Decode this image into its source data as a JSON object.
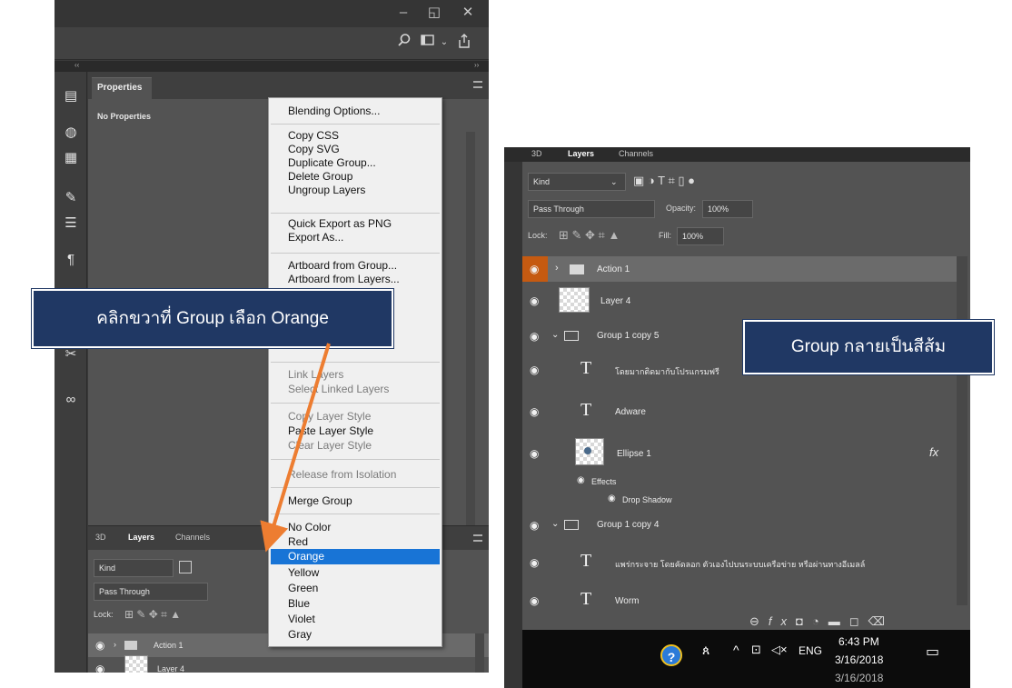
{
  "left_screenshot": {
    "window_controls": {
      "minimize": "–",
      "restore": "◱",
      "close": "✕"
    },
    "toolbar_icons": [
      "search-icon",
      "workspace-icon",
      "chevron-down-icon",
      "share-icon"
    ],
    "collapse_left": "‹‹",
    "collapse_right": "››",
    "properties_panel": {
      "tab_label": "Properties",
      "empty_text": "No Properties"
    },
    "context_menu": {
      "items": [
        {
          "label": "Blending Options...",
          "disabled": false
        },
        {
          "label": "Copy CSS",
          "disabled": false
        },
        {
          "label": "Copy SVG",
          "disabled": false
        },
        {
          "label": "Duplicate Group...",
          "disabled": false
        },
        {
          "label": "Delete Group",
          "disabled": false
        },
        {
          "label": "Ungroup Layers",
          "disabled": false
        },
        {
          "label": "Quick Export as PNG",
          "disabled": false
        },
        {
          "label": "Export As...",
          "disabled": false
        },
        {
          "label": "Artboard from Group...",
          "disabled": false
        },
        {
          "label": "Artboard from Layers...",
          "disabled": false
        },
        {
          "label": "Link Layers",
          "disabled": true
        },
        {
          "label": "Select Linked Layers",
          "disabled": true
        },
        {
          "label": "Copy Layer Style",
          "disabled": true
        },
        {
          "label": "Paste Layer Style",
          "disabled": false
        },
        {
          "label": "Clear Layer Style",
          "disabled": true
        },
        {
          "label": "Release from Isolation",
          "disabled": true
        },
        {
          "label": "Merge Group",
          "disabled": false
        },
        {
          "label": "No Color",
          "disabled": false
        },
        {
          "label": "Red",
          "disabled": false
        },
        {
          "label": "Orange",
          "disabled": false,
          "highlighted": true
        },
        {
          "label": "Yellow",
          "disabled": false
        },
        {
          "label": "Green",
          "disabled": false
        },
        {
          "label": "Blue",
          "disabled": false
        },
        {
          "label": "Violet",
          "disabled": false
        },
        {
          "label": "Gray",
          "disabled": false
        }
      ],
      "highlight_color": "#1874d6"
    },
    "layers_panel": {
      "tabs": [
        "3D",
        "Layers",
        "Channels"
      ],
      "filter_kind": "Kind",
      "blend_mode": "Pass Through",
      "lock_label": "Lock:",
      "layers": [
        {
          "name": "Action 1",
          "type": "group",
          "selected": true
        },
        {
          "name": "Layer 4",
          "type": "pixel"
        }
      ]
    },
    "callout": "คลิกขวาที่ Group เลือก Orange"
  },
  "right_screenshot": {
    "tabs": [
      "3D",
      "Layers",
      "Channels"
    ],
    "filter_kind": "Kind",
    "blend_mode": "Pass Through",
    "opacity_label": "Opacity:",
    "opacity_value": "100%",
    "lock_label": "Lock:",
    "fill_label": "Fill:",
    "fill_value": "100%",
    "layers": [
      {
        "name": "Action 1",
        "type": "group",
        "color": "orange",
        "selected": true
      },
      {
        "name": "Layer 4",
        "type": "pixel"
      },
      {
        "name": "Group 1 copy 5",
        "type": "group",
        "expanded": true
      },
      {
        "name": "โดยมากติดมากับโปรแกรมฟรี",
        "type": "text"
      },
      {
        "name": "Adware",
        "type": "text"
      },
      {
        "name": "Ellipse 1",
        "type": "shape",
        "fx": "fx"
      },
      {
        "name": "Effects",
        "type": "effects"
      },
      {
        "name": "Drop Shadow",
        "type": "effect"
      },
      {
        "name": "Group 1 copy 4",
        "type": "group",
        "expanded": true
      },
      {
        "name": "แพร่กระจาย โดยคัดลอก ตัวเองไปบนระบบเครือข่าย หรือผ่านทางอีเมลล์",
        "type": "text"
      },
      {
        "name": "Worm",
        "type": "text"
      }
    ],
    "bottom_icons": [
      "link-icon",
      "fx-icon",
      "mask-icon",
      "adjustment-icon",
      "folder-icon",
      "new-layer-icon",
      "trash-icon"
    ],
    "taskbar": {
      "time": "6:43 PM",
      "date": "3/16/2018",
      "date_ghost": "3/16/2018",
      "language": "ENG"
    },
    "callout": "Group กลายเป็นสีส้ม"
  },
  "colors": {
    "callout_bg": "#203864",
    "arrow": "#ed7d31",
    "group_orange": "#c55a11"
  }
}
